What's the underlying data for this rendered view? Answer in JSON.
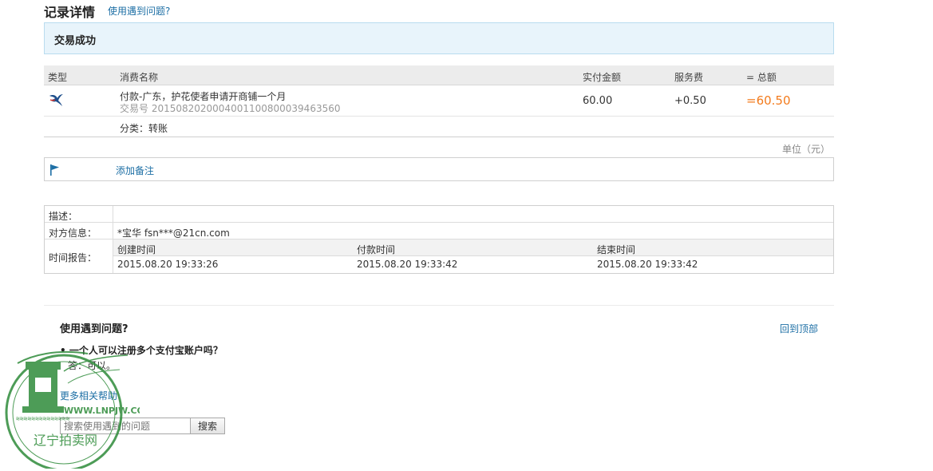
{
  "header": {
    "title": "记录详情",
    "help_link": "使用遇到问题?"
  },
  "status": {
    "text": "交易成功"
  },
  "table": {
    "headers": {
      "type": "类型",
      "name": "消费名称",
      "amount": "实付金额",
      "fee": "服务费",
      "total": "= 总额"
    },
    "row": {
      "type_icon": "swallow-logo-icon",
      "name": "付款-广东，护花使者申请开商铺一个月",
      "trade_no": "交易号 2015082020004001100800039463560",
      "amount": "60.00",
      "fee": "+0.50",
      "total": "=60.50"
    },
    "category": "分类：转账",
    "unit_note": "单位（元）"
  },
  "remark": {
    "icon": "flag-icon",
    "label": "添加备注"
  },
  "info": {
    "desc_label": "描述：",
    "desc_value": "",
    "party_label": "对方信息：",
    "party_value": "*宝华 fsn***@21cn.com",
    "time_label": "时间报告：",
    "time_headers": [
      "创建时间",
      "付款时间",
      "结束时间"
    ],
    "time_values": [
      "2015.08.20 19:33:26",
      "2015.08.20 19:33:42",
      "2015.08.20 19:33:42"
    ]
  },
  "help": {
    "title": "使用遇到问题?",
    "back_to_top": "回到顶部",
    "faq_question": "• 一个人可以注册多个支付宝账户吗？",
    "faq_answer": "答：可以。",
    "more_help": "更多相关帮助",
    "search_placeholder": "搜索使用遇到的问题",
    "search_button": "搜索"
  },
  "watermark": {
    "url_text": "WWW.LNPJW.COM",
    "site_name": "辽宁拍卖网"
  },
  "colors": {
    "accent_link": "#1d6fa5",
    "total_orange": "#f37b1d",
    "status_bg": "#e8f4fb",
    "watermark_green": "#2e8b3a"
  }
}
